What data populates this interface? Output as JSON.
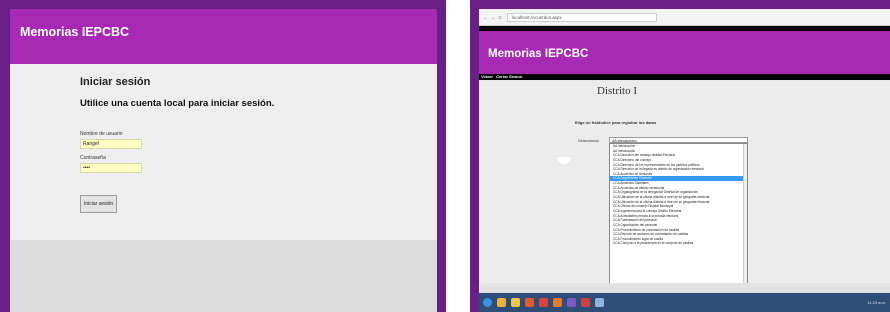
{
  "left": {
    "app_title": "Memorias IEPCBC",
    "login_title": "Iniciar sesión",
    "login_subtitle": "Utilice una cuenta local para iniciar sesión.",
    "username_label": "Nombre de usuario",
    "username_value": "Rangel",
    "password_label": "Contraseña",
    "password_value": "••••",
    "login_button": "Iniciar sesión"
  },
  "right": {
    "browser": {
      "nav": "← → C",
      "url": "localhost:/Acuerdos.aspx"
    },
    "app_title": "Memorias IEPCBC",
    "menu": [
      "Volver",
      "Cerrar Sesion"
    ],
    "district_title": "Distrito I",
    "instruction": "Elige un fraldodice para registrar los datos",
    "select_label": "Seleccionar",
    "selected_value": "AA Introducción",
    "options": [
      "AA Introducción",
      "AA Introducción",
      "CCA Direccion del consejo distrital Electoral",
      "CCA Directorio del consejo",
      "CCA Directorio de los representantes de los partidos politicos",
      "CCA Dirección de la llegada en distrito de organización electoral",
      "CCA Acuerdos de Sesiones",
      "CCA Seguimiento Electoral",
      "CCA Acuerdos Distritales",
      "CCA Acuerdos de distrito ceremonia",
      "CCA Organigrama de la delegación Distrital de organización",
      "CCA Ubicación de la oficina distrital a nivel de su geografía electoral",
      "CCA Ubicación de la oficina distrital a nivel de su geografía electoral",
      "CCA Oficina del consejo Distrital Municipal",
      "CCA Ingeniería para el consejo Distrito Electoral",
      "CCA Actividades previas a la jornada electoral",
      "CCA Contratación del personal",
      "CCA Capacitación del personal",
      "CCA Procedimiento de contratación de casillas",
      "CCA Reporte de acciones de contratación de casillas",
      "CCA Procedimiento lugar de casilla",
      "CCA Cómputo a la presidencia en el cómputo de casillas"
    ],
    "selected_index": 7,
    "clock": "11:23 a.m."
  },
  "colors": {
    "frame": "#6a1f86",
    "header": "#a72ab4",
    "taskbar": "#2f4e77",
    "highlight": "#3399ff"
  },
  "taskbar_icons": [
    "windows-start-icon",
    "explorer-icon",
    "folder-icon",
    "media-icon",
    "chrome-icon",
    "firefox-icon",
    "visual-studio-icon",
    "snipping-icon",
    "paint-icon"
  ]
}
